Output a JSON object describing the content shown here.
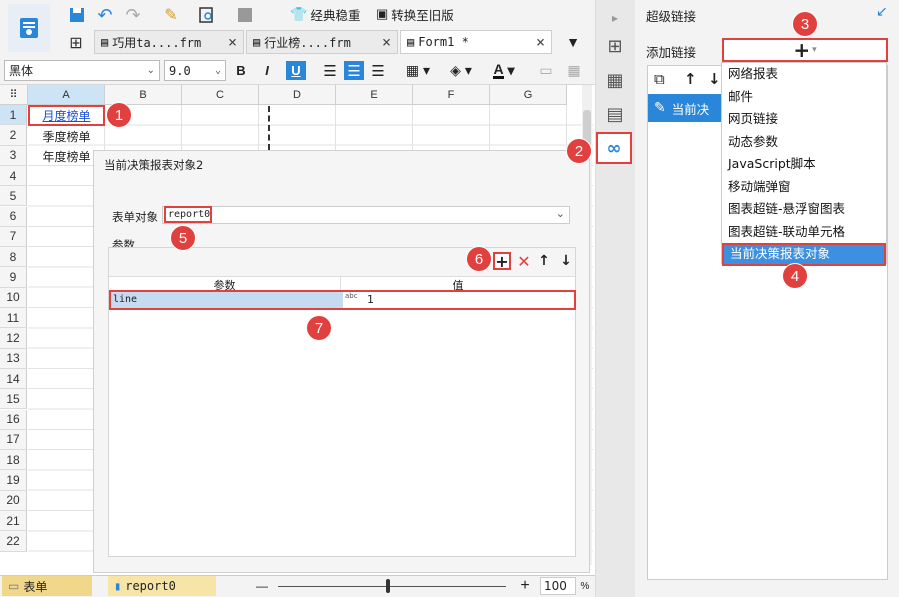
{
  "toolbar": {
    "classic_label": "经典稳重",
    "convert_label": "转换至旧版"
  },
  "tabs": [
    {
      "label": "巧用ta....frm",
      "close": "×"
    },
    {
      "label": "行业榜....frm",
      "close": "×"
    },
    {
      "label": "Form1 *",
      "close": "×"
    }
  ],
  "format": {
    "font_name": "黑体",
    "font_size": "9.0",
    "bold": "B",
    "italic": "I",
    "underline": "U",
    "font_color": "A"
  },
  "sheet": {
    "corner": "⠿",
    "columns": [
      "A",
      "B",
      "C",
      "D",
      "E",
      "F",
      "G"
    ],
    "rows": [
      "1",
      "2",
      "3",
      "4",
      "5",
      "6",
      "7",
      "8",
      "9",
      "10",
      "11",
      "12",
      "13",
      "14",
      "15",
      "16",
      "17",
      "18",
      "19",
      "20",
      "21",
      "22"
    ],
    "cells": {
      "A1": "月度榜单",
      "A2": "季度榜单",
      "A3": "年度榜单"
    }
  },
  "bottom": {
    "tab_form": "表单",
    "tab_report": "report0",
    "zoom_minus": "—",
    "zoom_plus": "+",
    "zoom_value": "100",
    "zoom_unit": "%"
  },
  "dialog": {
    "title": "当前决策报表对象2",
    "form_object_label": "表单对象",
    "form_object_value": "report0",
    "params_label": "参数",
    "table_headers": [
      "参数",
      "值"
    ],
    "row": {
      "param": "line",
      "type_icon": "abc",
      "value": "1"
    }
  },
  "right_panel": {
    "title": "超级链接",
    "add_link_label": "添加链接",
    "add_symbol": "+",
    "list_item": "当前决",
    "menu": [
      "网络报表",
      "邮件",
      "网页链接",
      "动态参数",
      "JavaScript脚本",
      "移动端弹窗",
      "图表超链-悬浮窗图表",
      "图表超链-联动单元格",
      "当前决策报表对象"
    ]
  },
  "badges": [
    "1",
    "2",
    "3",
    "4",
    "5",
    "6",
    "7"
  ],
  "colors": {
    "accent": "#2a86d8",
    "annotation": "#e0403e",
    "selected": "#3d8fe0"
  }
}
